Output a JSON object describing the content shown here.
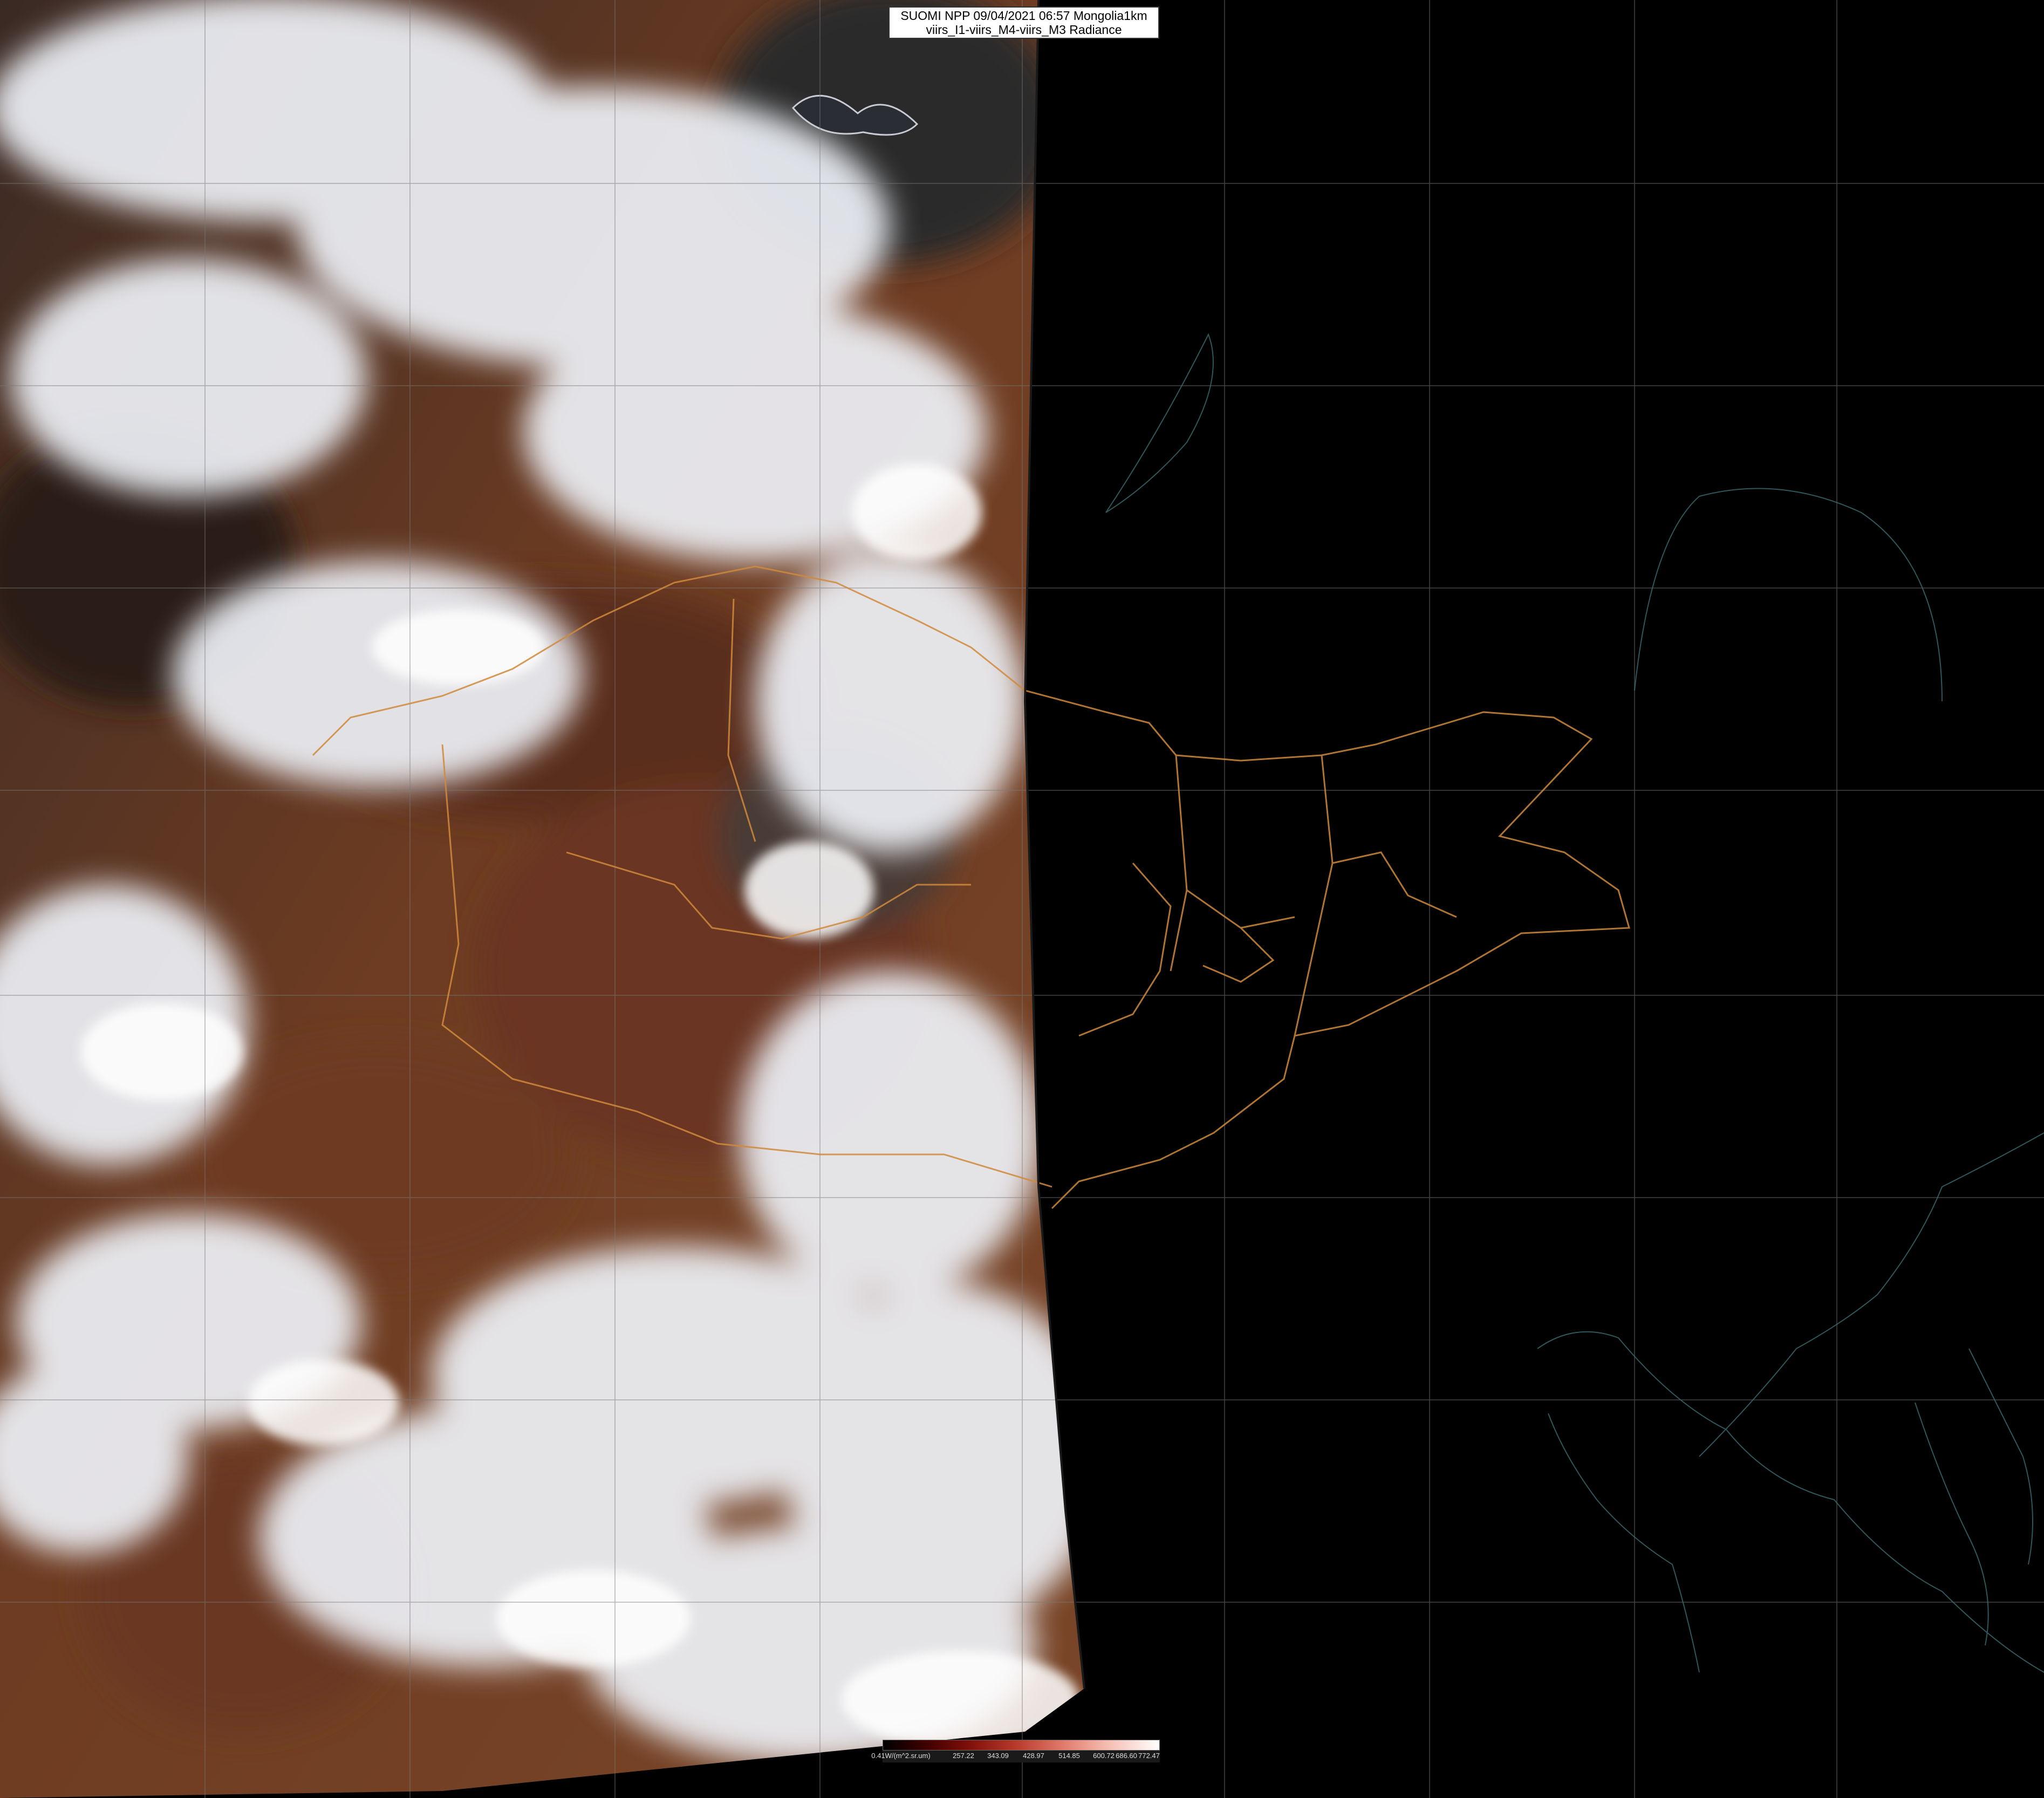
{
  "header": {
    "line1": "SUOMI NPP 09/04/2021 06:57 Mongolia1km",
    "line2": "viirs_I1-viirs_M4-viirs_M3 Radiance"
  },
  "colorbar": {
    "labels": [
      "0.41W/(m^2.sr.um)",
      "257.22",
      "343.09",
      "428.97",
      "514.85",
      "600.72",
      "686.60",
      "772.47"
    ],
    "colors": {
      "low": "#000000",
      "mid": "#b83a2b",
      "high": "#ffffff"
    }
  },
  "colors": {
    "cloud": "#f2f4f8",
    "land": "#6a3a22",
    "night": "#000000",
    "border": "#d08a3c",
    "coast": "#3a6e72",
    "grid": "#7a7a7a"
  }
}
